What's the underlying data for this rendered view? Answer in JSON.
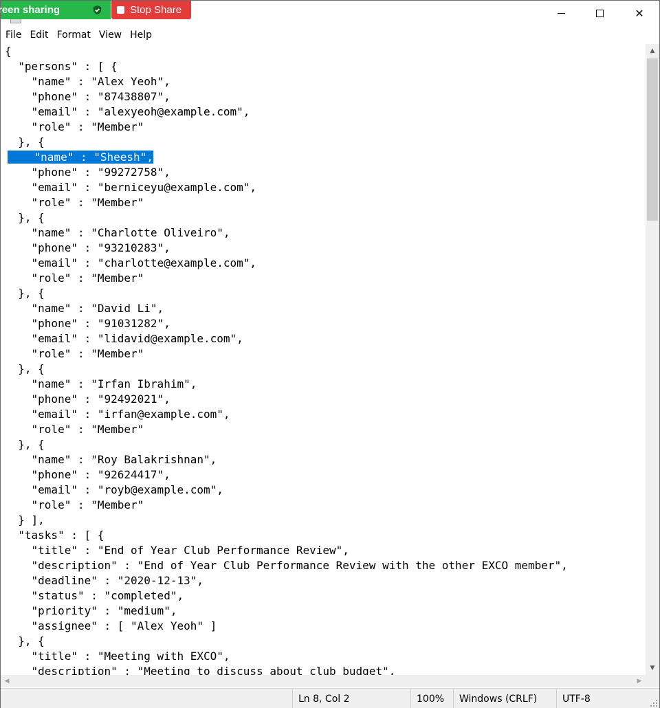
{
  "overlay": {
    "sharing_label": "reen sharing",
    "stop_label": "Stop Share"
  },
  "window_controls": {
    "minimize": "minimize-icon",
    "maximize": "maximize-icon",
    "close": "close-icon",
    "close_glyph": "✕"
  },
  "menu": {
    "file": "File",
    "edit": "Edit",
    "format": "Format",
    "view": "View",
    "help": "Help"
  },
  "editor": {
    "lines": [
      "{",
      "  \"persons\" : [ {",
      "    \"name\" : \"Alex Yeoh\",",
      "    \"phone\" : \"87438807\",",
      "    \"email\" : \"alexyeoh@example.com\",",
      "    \"role\" : \"Member\"",
      "  }, {",
      "    \"name\" : \"Sheesh\",",
      "    \"phone\" : \"99272758\",",
      "    \"email\" : \"berniceyu@example.com\",",
      "    \"role\" : \"Member\"",
      "  }, {",
      "    \"name\" : \"Charlotte Oliveiro\",",
      "    \"phone\" : \"93210283\",",
      "    \"email\" : \"charlotte@example.com\",",
      "    \"role\" : \"Member\"",
      "  }, {",
      "    \"name\" : \"David Li\",",
      "    \"phone\" : \"91031282\",",
      "    \"email\" : \"lidavid@example.com\",",
      "    \"role\" : \"Member\"",
      "  }, {",
      "    \"name\" : \"Irfan Ibrahim\",",
      "    \"phone\" : \"92492021\",",
      "    \"email\" : \"irfan@example.com\",",
      "    \"role\" : \"Member\"",
      "  }, {",
      "    \"name\" : \"Roy Balakrishnan\",",
      "    \"phone\" : \"92624417\",",
      "    \"email\" : \"royb@example.com\",",
      "    \"role\" : \"Member\"",
      "  } ],",
      "  \"tasks\" : [ {",
      "    \"title\" : \"End of Year Club Performance Review\",",
      "    \"description\" : \"End of Year Club Performance Review with the other EXCO member\",",
      "    \"deadline\" : \"2020-12-13\",",
      "    \"status\" : \"completed\",",
      "    \"priority\" : \"medium\",",
      "    \"assignee\" : [ \"Alex Yeoh\" ]",
      "  }, {",
      "    \"title\" : \"Meeting with EXCO\",",
      "    \"description\" : \"Meeting to discuss about club budget\","
    ],
    "selected_line": 7,
    "selection_color": "#0078d7"
  },
  "status": {
    "position": "Ln 8, Col 2",
    "zoom": "100%",
    "line_ending": "Windows (CRLF)",
    "encoding": "UTF-8"
  }
}
